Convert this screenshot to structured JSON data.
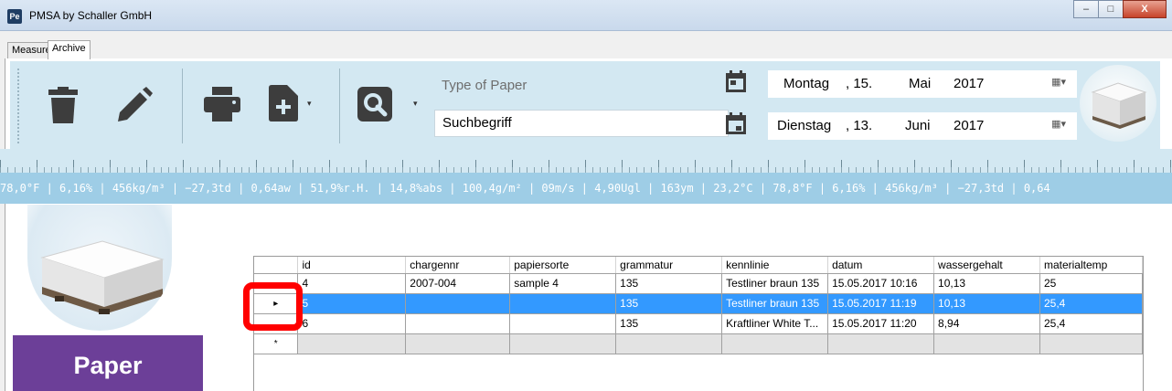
{
  "window": {
    "icon_text": "Pe",
    "title": "PMSA by Schaller GmbH",
    "minimize_glyph": "–",
    "maximize_glyph": "□",
    "close_glyph": "X"
  },
  "tabs": [
    {
      "label": "Measure",
      "active": false
    },
    {
      "label": "Archive",
      "active": true
    }
  ],
  "toolbar": {
    "icons": [
      "trash-icon",
      "pencil-icon",
      "printer-icon",
      "new-file-icon",
      "search-icon"
    ],
    "dropdown_glyph": "▾",
    "type_label": "Type of Paper",
    "search_value": "Suchbegriff",
    "date_from": {
      "weekday": "Montag",
      "day": ", 15.",
      "month": "Mai",
      "year": "2017"
    },
    "date_to": {
      "weekday": "Dienstag",
      "day": ", 13.",
      "month": "Juni",
      "year": "2017"
    },
    "calendar_button_glyph": "▦▾"
  },
  "ticker_text": "78,0°F | 6,16% | 456kg/m³ | −27,3td | 0,64aw | 51,9%r.H. | 14,8%abs | 100,4g/m² | 09m/s | 4,90Ugl | 163ym | 23,2°C | 78,8°F | 6,16% | 456kg/m³ | −27,3td | 0,64",
  "left_panel": {
    "paper_button": "Paper"
  },
  "grid": {
    "columns": [
      "id",
      "chargennr",
      "papiersorte",
      "grammatur",
      "kennlinie",
      "datum",
      "wassergehalt",
      "materialtemp"
    ],
    "rows": [
      {
        "marker": "",
        "cells": [
          "4",
          "2007-004",
          "sample 4",
          "135",
          "Testliner braun 135",
          "15.05.2017 10:16",
          "10,13",
          "25"
        ],
        "selected": false
      },
      {
        "marker": "▸",
        "cells": [
          "5",
          "",
          "",
          "135",
          "Testliner braun 135",
          "15.05.2017 11:19",
          "10,13",
          "25,4"
        ],
        "selected": true
      },
      {
        "marker": "",
        "cells": [
          "6",
          "",
          "",
          "135",
          "Kraftliner White T...",
          "15.05.2017 11:20",
          "8,94",
          "25,4"
        ],
        "selected": false
      }
    ],
    "new_row_marker": "*"
  },
  "colors": {
    "toolbar_bg": "#d3e8f2",
    "ticker_bg": "#9ecde6",
    "selection": "#3399ff",
    "paper_button": "#6c3f98",
    "highlight": "#ff0000"
  }
}
